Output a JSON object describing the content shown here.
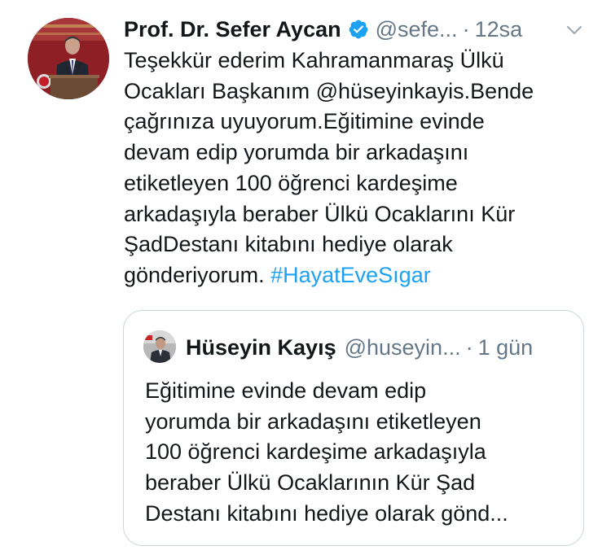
{
  "tweet": {
    "author_name": "Prof. Dr. Sefer Aycan",
    "verified_icon": "verified-badge-icon",
    "handle": "@sefe...",
    "separator": "·",
    "time": "12sa",
    "menu_icon": "chevron-down-icon",
    "body_lines": [
      "Teşekkür ederim Kahramanmaraş Ülkü",
      "Ocakları Başkanım @hüseyinkayis.Bende",
      "çağrınıza uyuyorum.Eğitimine evinde",
      "devam edip yorumda bir arkadaşını",
      "etiketleyen 100 öğrenci kardeşime",
      "arkadaşıyla beraber Ülkü Ocaklarını Kür",
      "ŞadDestanı kitabını hediye olarak"
    ],
    "last_line_text": "gönderiyorum. ",
    "hashtag": "#HayatEveSıgar",
    "colors": {
      "text": "#14171a",
      "secondary": "#657786",
      "accent": "#1da1f2",
      "border": "#ccd6dd"
    }
  },
  "quoted_tweet": {
    "author_name": "Hüseyin Kayış",
    "handle": "@huseyin...",
    "separator": "·",
    "time": "1 gün",
    "body_lines": [
      "Eğitimine evinde devam edip",
      "yorumda bir arkadaşını etiketleyen",
      "100 öğrenci kardeşime arkadaşıyla",
      "beraber Ülkü Ocaklarının Kür Şad",
      "Destanı kitabını hediye olarak gönd..."
    ]
  }
}
